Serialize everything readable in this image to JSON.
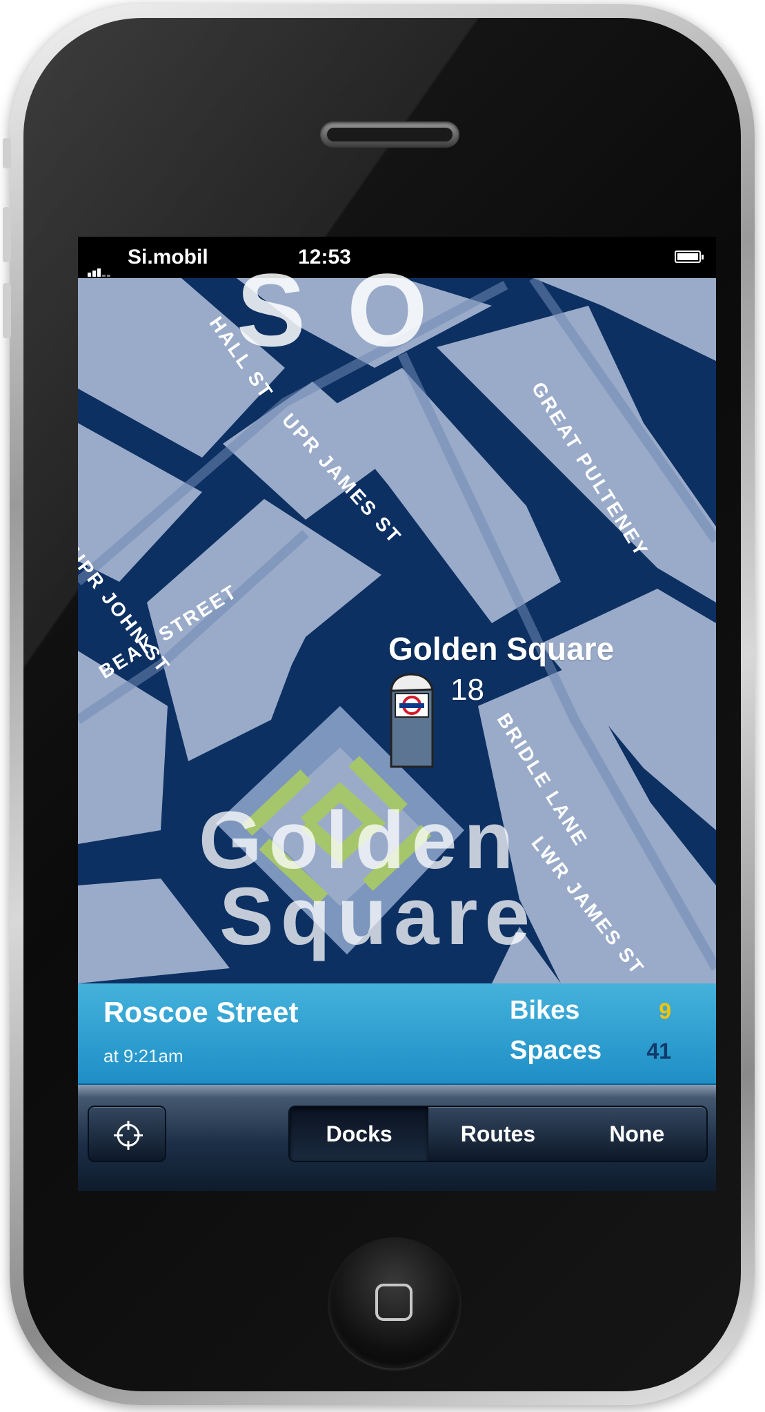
{
  "status_bar": {
    "carrier": "Si.mobil",
    "time": "12:53"
  },
  "map": {
    "district_label": "SO",
    "area_label_line1": "Golden",
    "area_label_line2": "Square",
    "streets": [
      "HALL ST",
      "BEAK STREET",
      "UPR JAMES ST",
      "UPR JOHN ST",
      "GREAT PULTENEY",
      "BRIDLE LANE",
      "LWR JAMES ST"
    ],
    "station": {
      "name": "Golden Square",
      "count": "18"
    }
  },
  "info_panel": {
    "station_name": "Roscoe Street",
    "updated": "at 9:21am",
    "bikes_label": "Bikes",
    "bikes_value": "9",
    "spaces_label": "Spaces",
    "spaces_value": "41"
  },
  "toolbar": {
    "segments": [
      "Docks",
      "Routes",
      "None"
    ],
    "selected": "Docks"
  },
  "colors": {
    "road": "#0d3062",
    "block": "#9aabc9",
    "park": "#a6c66c",
    "info_panel": "#2f9fd0",
    "bikes_value": "#f5c400",
    "spaces_value": "#103a6b"
  }
}
